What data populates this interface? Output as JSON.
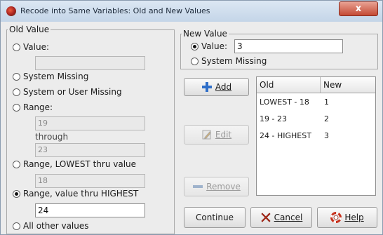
{
  "window": {
    "title": "Recode into Same Variables: Old and New Values",
    "close_label": "x"
  },
  "old_value": {
    "group_title": "Old Value",
    "value_label": "Value:",
    "value_input": "",
    "system_missing_label": "System Missing",
    "system_or_user_missing_label": "System or User Missing",
    "range_label": "Range:",
    "range_from": "19",
    "through_label": "through",
    "range_to": "23",
    "lowest_thru_label": "Range, LOWEST thru value",
    "lowest_thru_value": "18",
    "thru_highest_label": "Range, value thru HIGHEST",
    "thru_highest_value": "24",
    "all_other_label": "All other values",
    "selected": "Range, value thru HIGHEST"
  },
  "new_value": {
    "group_title": "New Value",
    "value_label": "Value:",
    "value_input": "3",
    "system_missing_label": "System Missing",
    "selected": "Value:"
  },
  "buttons": {
    "add": "Add",
    "edit": "Edit",
    "remove": "Remove",
    "continue": "Continue",
    "cancel": "Cancel",
    "help": "Help"
  },
  "mapping_table": {
    "columns": [
      "Old",
      "New"
    ],
    "rows": [
      {
        "old": "LOWEST - 18",
        "new": "1"
      },
      {
        "old": "19 - 23",
        "new": "2"
      },
      {
        "old": "24 - HIGHEST",
        "new": "3"
      }
    ]
  },
  "colors": {
    "titlebar": "#c4d5e8",
    "close_button": "#c44a35",
    "add_icon": "#2f6fc9",
    "cancel_icon": "#c8321e",
    "help_icon": "#c8321e"
  }
}
